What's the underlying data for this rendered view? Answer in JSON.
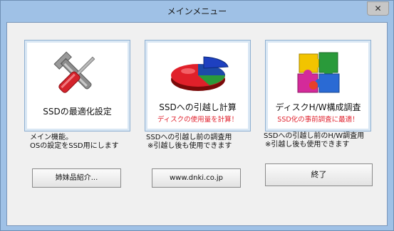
{
  "window": {
    "title": "メインメニュー",
    "close_glyph": "✕"
  },
  "buttons": {
    "optimize": {
      "label": "SSDの最適化設定",
      "icon": "tools-icon"
    },
    "migrate": {
      "label": "SSDへの引越し計算",
      "sublabel": "ディスクの使用量を計算！",
      "icon": "pie-chart-icon"
    },
    "survey": {
      "label": "ディスクH/W構成調査",
      "sublabel": "SSD化の事前調査に最適！",
      "icon": "puzzle-icon"
    }
  },
  "descriptions": {
    "optimize": [
      "メイン機能。",
      "OSの設定をSSD用にします"
    ],
    "migrate": [
      "SSDへの引越し前の調査用",
      "※引越し後も使用できます"
    ],
    "survey": [
      "SSDへの引越し前のH/W調査用",
      "※引越し後も使用できます"
    ]
  },
  "footer": {
    "sister_products": "姉妹品紹介...",
    "website": "www.dnki.co.jp",
    "exit": "終了"
  }
}
